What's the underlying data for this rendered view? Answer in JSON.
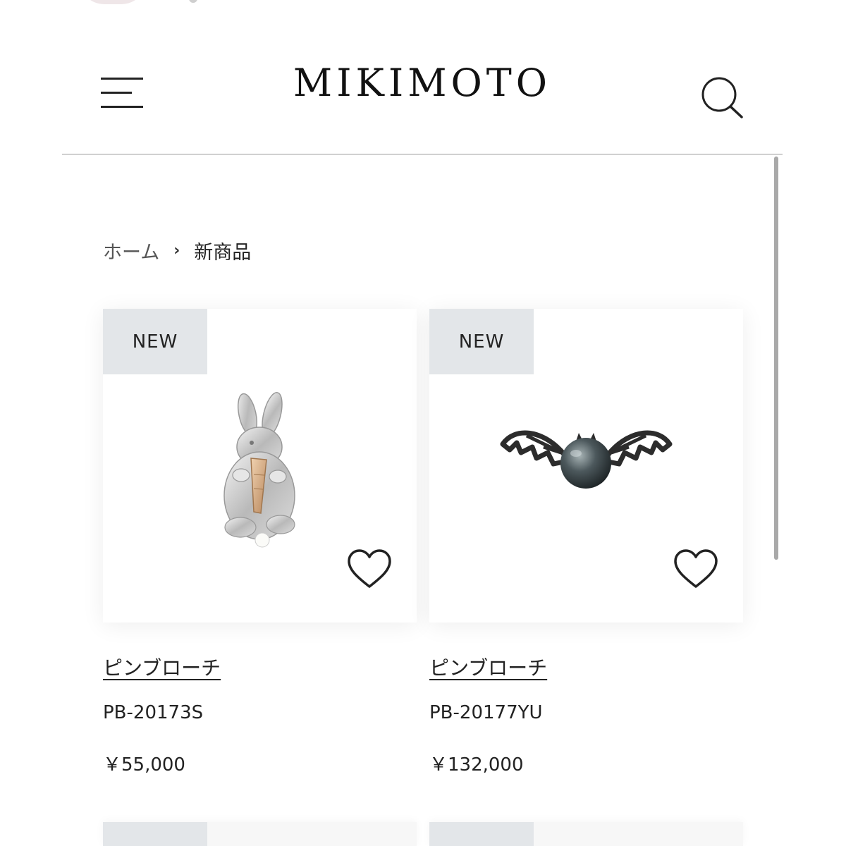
{
  "header": {
    "brand": "MIKIMOTO",
    "menu_icon": "hamburger-menu-icon",
    "search_icon": "search-icon"
  },
  "breadcrumb": {
    "home": "ホーム",
    "separator": "›",
    "current": "新商品"
  },
  "products": [
    {
      "badge": "NEW",
      "name": "ピンブローチ",
      "sku": "PB-20173S",
      "price": "￥55,000",
      "image": "rabbit-brooch-image",
      "favorite_icon": "heart-icon"
    },
    {
      "badge": "NEW",
      "name": "ピンブローチ",
      "sku": "PB-20177YU",
      "price": "￥132,000",
      "image": "bat-pearl-brooch-image",
      "favorite_icon": "heart-icon"
    }
  ],
  "colors": {
    "text": "#222222",
    "badge_bg": "#e3e6e9",
    "divider": "#d0d0d0"
  }
}
